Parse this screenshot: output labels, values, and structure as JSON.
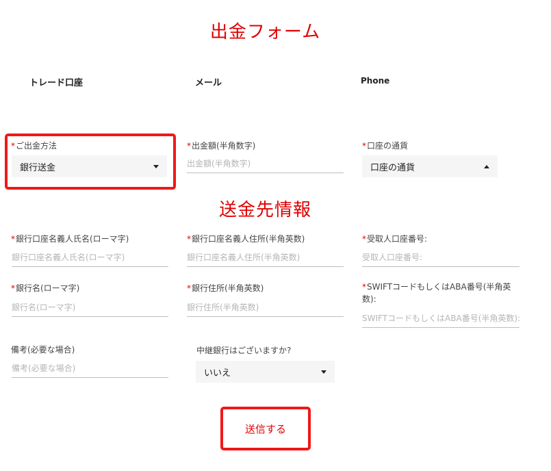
{
  "form_title": "出金フォーム",
  "section_title": "送金先情報",
  "account": {
    "trade_account_label": "トレード口座",
    "email_label": "メール",
    "phone_label": "Phone"
  },
  "required_mark": "*",
  "withdrawal": {
    "method": {
      "label": "ご出金方法",
      "value": "銀行送金"
    },
    "amount": {
      "label": "出金額(半角数字)",
      "placeholder": "出金額(半角数字)"
    },
    "currency": {
      "label": "口座の通貨",
      "value": "口座の通貨"
    }
  },
  "beneficiary": {
    "holder_name": {
      "label": "銀行口座名義人氏名(ローマ字)",
      "placeholder": "銀行口座名義人氏名(ローマ字)"
    },
    "holder_address": {
      "label": "銀行口座名義人住所(半角英数)",
      "placeholder": "銀行口座名義人住所(半角英数)"
    },
    "account_number": {
      "label": "受取人口座番号:",
      "placeholder": "受取人口座番号:"
    },
    "bank_name": {
      "label": "銀行名(ローマ字)",
      "placeholder": "銀行名(ローマ字)"
    },
    "bank_address": {
      "label": "銀行住所(半角英数)",
      "placeholder": "銀行住所(半角英数)"
    },
    "swift": {
      "label": "SWIFTコードもしくはABA番号(半角英数):",
      "placeholder": "SWIFTコードもしくはABA番号(半角英数):"
    },
    "notes": {
      "label": "備考(必要な場合)",
      "placeholder": "備考(必要な場合)"
    },
    "intermediary": {
      "label": "中継銀行はございますか?",
      "value": "いいえ"
    }
  },
  "submit_label": "送信する",
  "colors": {
    "accent": "#e00000",
    "highlight": "#f01818",
    "select_bg": "#f5f5f5"
  }
}
